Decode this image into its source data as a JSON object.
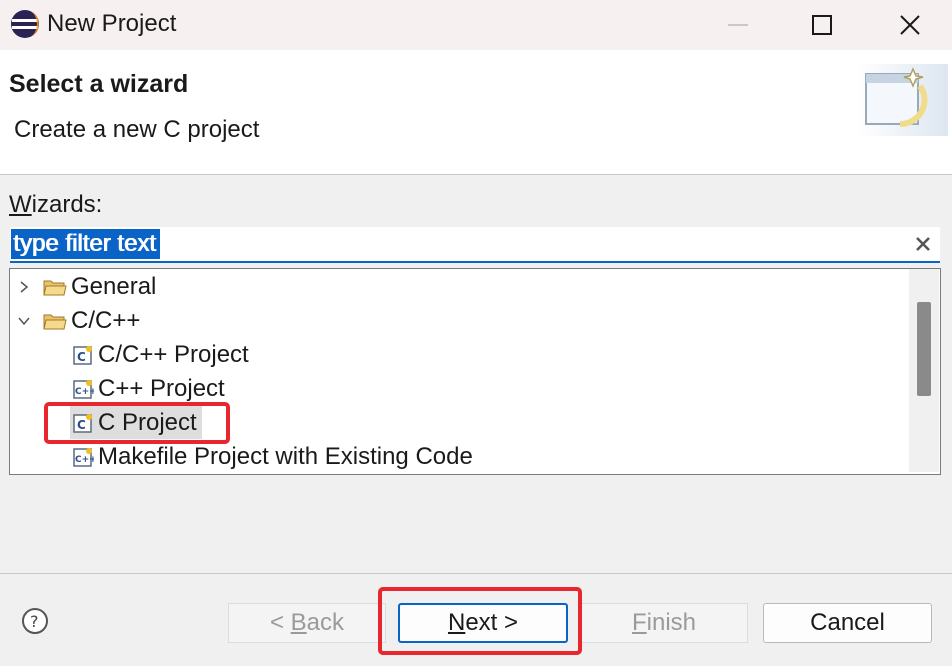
{
  "window": {
    "title": "New Project",
    "icons": {
      "app": "eclipse-icon",
      "minimize": "minimize-icon",
      "maximize": "maximize-icon",
      "close": "close-icon"
    }
  },
  "header": {
    "title": "Select a wizard",
    "description": "Create a new C project",
    "banner_icon": "new-wizard-icon"
  },
  "wizards": {
    "label_mnemonic": "W",
    "label_rest": "izards:",
    "filter_value": "type filter text",
    "clear_icon": "clear-icon"
  },
  "tree": {
    "items": [
      {
        "label": "General",
        "expanded": false,
        "icon": "folder-icon"
      },
      {
        "label": "C/C++",
        "expanded": true,
        "icon": "folder-icon"
      },
      {
        "label": "C/C++ Project",
        "icon": "c-project-icon"
      },
      {
        "label": "C++ Project",
        "icon": "cpp-project-icon"
      },
      {
        "label": "C Project",
        "icon": "c-project-icon",
        "selected": true
      },
      {
        "label": "Makefile Project with Existing Code",
        "icon": "cpp-project-icon"
      }
    ]
  },
  "footer": {
    "help_icon": "help-icon",
    "back": {
      "prefix": "< ",
      "mnemonic": "B",
      "rest": "ack",
      "enabled": false
    },
    "next": {
      "mnemonic": "N",
      "rest": "ext >",
      "enabled": true
    },
    "finish": {
      "mnemonic": "F",
      "rest": "inish",
      "enabled": false
    },
    "cancel": {
      "label": "Cancel",
      "enabled": true
    }
  },
  "colors": {
    "accent": "#0a64c8",
    "highlight_annotation": "#e8262e",
    "titlebar": "#f7f0f0",
    "panel": "#f0f0f0"
  }
}
